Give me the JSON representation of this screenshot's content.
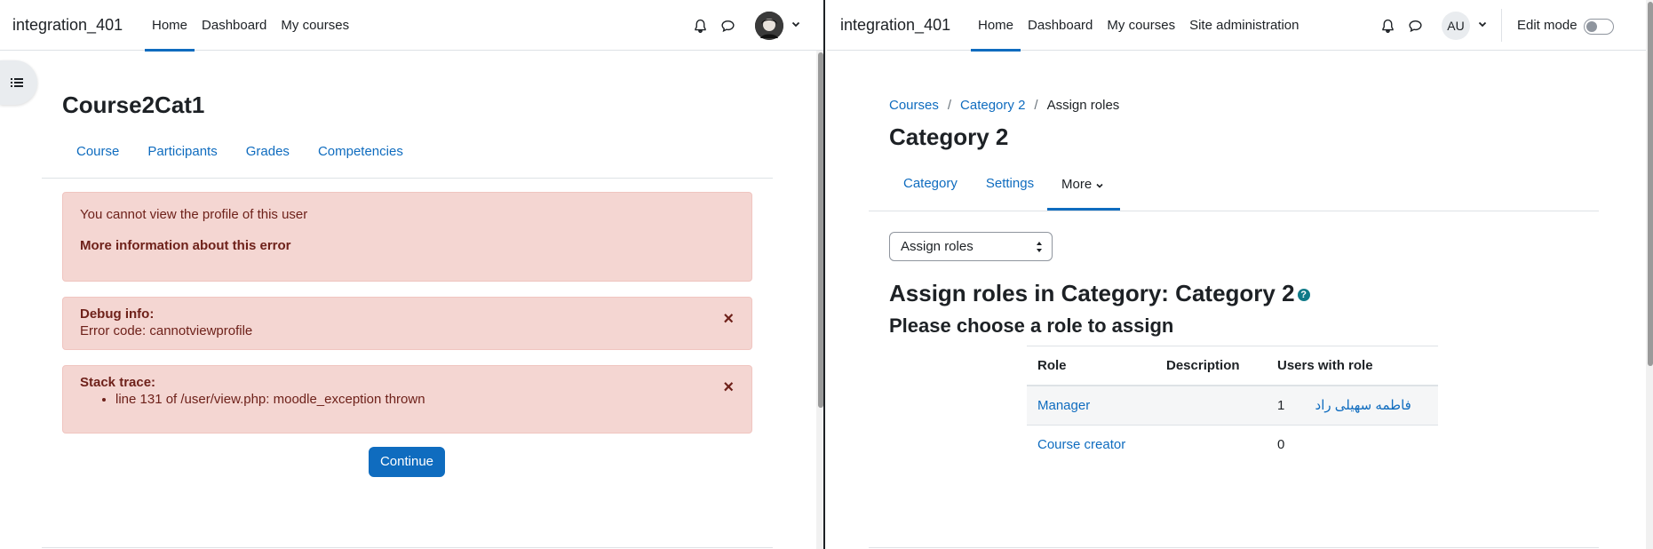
{
  "left": {
    "navbar": {
      "brand": "integration_401",
      "links": [
        "Home",
        "Dashboard",
        "My courses"
      ]
    },
    "page_title": "Course2Cat1",
    "secondary_nav": [
      "Course",
      "Participants",
      "Grades",
      "Competencies"
    ],
    "error_alert": {
      "message": "You cannot view the profile of this user",
      "more_info": "More information about this error"
    },
    "debug_alert": {
      "title": "Debug info:",
      "text": "Error code: cannotviewprofile",
      "close": "×"
    },
    "stack_alert": {
      "title": "Stack trace:",
      "item": "line 131 of /user/view.php: moodle_exception thrown",
      "close": "×"
    },
    "continue_label": "Continue"
  },
  "right": {
    "navbar": {
      "brand": "integration_401",
      "links": [
        "Home",
        "Dashboard",
        "My courses",
        "Site administration"
      ],
      "avatar_initials": "AU",
      "edit_mode_label": "Edit mode"
    },
    "breadcrumb": [
      "Courses",
      "Category 2",
      "Assign roles"
    ],
    "breadcrumb_sep": "/",
    "page_title": "Category 2",
    "secondary_nav": [
      "Category",
      "Settings",
      "More"
    ],
    "select_value": "Assign roles",
    "heading": "Assign roles in Category: Category 2",
    "help_icon": "?",
    "subheading": "Please choose a role to assign",
    "table": {
      "headers": [
        "Role",
        "Description",
        "Users with role"
      ],
      "rows": [
        {
          "role": "Manager",
          "description": "",
          "count": "1",
          "user": "فاطمه سهیلی راد"
        },
        {
          "role": "Course creator",
          "description": "",
          "count": "0",
          "user": ""
        }
      ]
    }
  },
  "colors": {
    "primary": "#0f6cbf",
    "danger_bg": "#f4d6d2",
    "danger_text": "#6e211a"
  }
}
